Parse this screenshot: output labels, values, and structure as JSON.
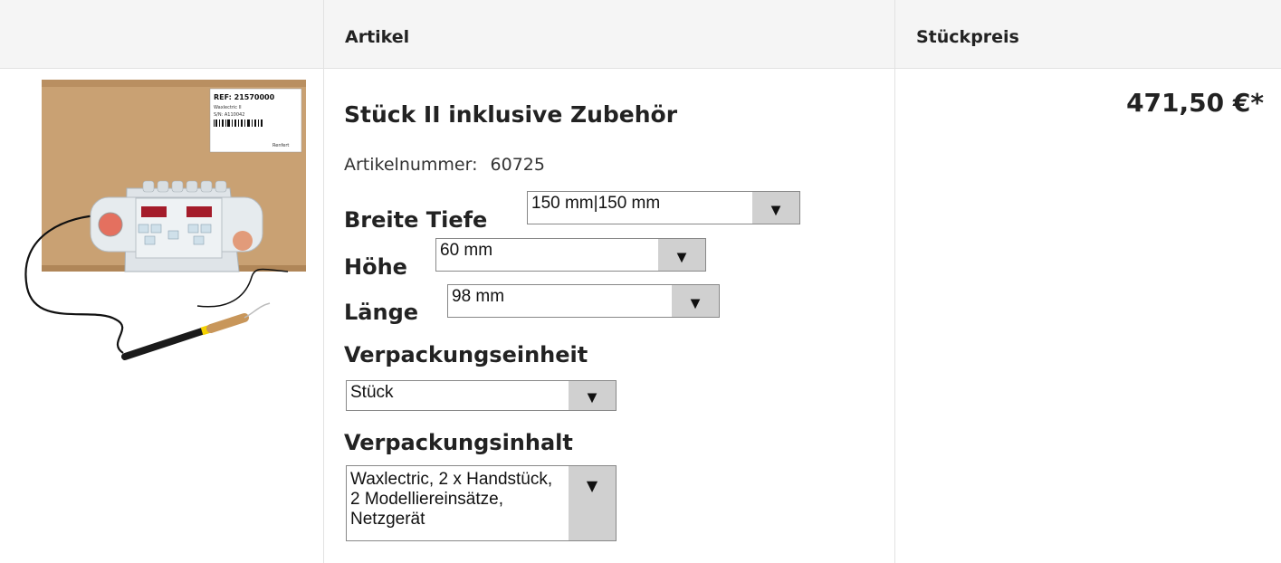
{
  "header": {
    "col_article": "Artikel",
    "col_price": "Stückpreis"
  },
  "product": {
    "image_icon": "waxlectric-product-image",
    "box_label_ref": "REF: 21570000",
    "box_label_name": "Waxlectric II",
    "box_label_sn": "S/N: A110042",
    "box_label_brand": "Renfert",
    "title": "Stück II inklusive Zubehör",
    "artnr_label": "Artikelnummer:",
    "artnr_value": "60725",
    "price": "471,50 €*"
  },
  "options": {
    "breite_tiefe": {
      "label": "Breite Tiefe",
      "value": "150 mm|150 mm"
    },
    "hoehe": {
      "label": "Höhe",
      "value": "60 mm"
    },
    "laenge": {
      "label": "Länge",
      "value": "98 mm"
    },
    "verpackungseinheit": {
      "label": "Verpackungseinheit",
      "value": "Stück"
    },
    "verpackungsinhalt": {
      "label": "Verpackungsinhalt",
      "value": "Waxlectric, 2 x Handstück, 2 Modelliereinsätze, Netzgerät"
    }
  },
  "colors": {
    "header_bg": "#f5f5f5",
    "border": "#e2e2e2",
    "select_button": "#d0d0d0",
    "cardboard": "#c9a173"
  }
}
